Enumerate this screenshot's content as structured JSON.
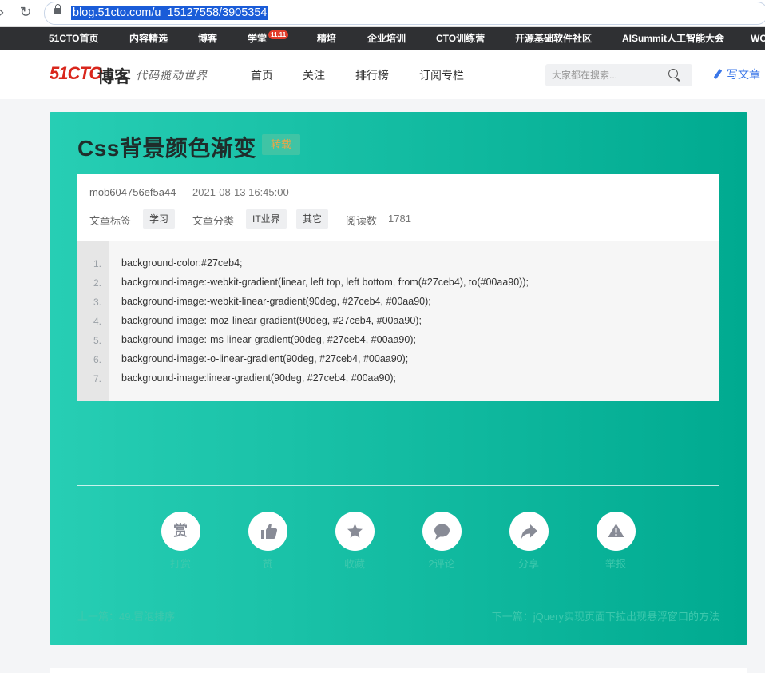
{
  "browser": {
    "url": "blog.51cto.com/u_15127558/3905354"
  },
  "topnav": {
    "items": [
      "51CTO首页",
      "内容精选",
      "博客",
      "学堂",
      "精培",
      "企业培训",
      "CTO训练营",
      "开源基础软件社区",
      "AISummit人工智能大会",
      "WOT"
    ],
    "badge": "11.11"
  },
  "header": {
    "logo_main": "51CTO",
    "logo_sub": "博客",
    "logo_slogan": "代码揽动世界",
    "nav": [
      "首页",
      "关注",
      "排行榜",
      "订阅专栏"
    ],
    "search_placeholder": "大家都在搜索...",
    "write_label": "写文章"
  },
  "article": {
    "title": "Css背景颜色渐变",
    "repost_badge": "转载",
    "author": "mob604756ef5a44",
    "time": "2021-08-13 16:45:00",
    "tag_label": "文章标签",
    "tags": [
      "学习"
    ],
    "category_label": "文章分类",
    "categories": [
      "IT业界",
      "其它"
    ],
    "read_label": "阅读数",
    "read_count": "1781",
    "code_lines": [
      "background-color:#27ceb4;",
      "background-image:-webkit-gradient(linear, left top, left bottom, from(#27ceb4), to(#00aa90));",
      "background-image:-webkit-linear-gradient(90deg, #27ceb4, #00aa90);",
      "background-image:-moz-linear-gradient(90deg, #27ceb4, #00aa90);",
      "background-image:-ms-linear-gradient(90deg, #27ceb4, #00aa90);",
      "background-image:-o-linear-gradient(90deg, #27ceb4, #00aa90);",
      "background-image:linear-gradient(90deg, #27ceb4, #00aa90);"
    ],
    "line_numbers": [
      "1.",
      "2.",
      "3.",
      "4.",
      "5.",
      "6.",
      "7."
    ],
    "actions": {
      "reward_glyph": "赏",
      "reward": "打赏",
      "like": "赞",
      "collect": "收藏",
      "comment": "2评论",
      "share": "分享",
      "report": "举报"
    },
    "prev": "上一篇：49.冒泡排序",
    "next": "下一篇：jQuery实现页面下拉出现悬浮窗口的方法"
  },
  "colors": {
    "gradient_start": "#27ceb4",
    "gradient_end": "#00aa90",
    "brand_red": "#d9261c",
    "accent_blue": "#3b77e8"
  }
}
